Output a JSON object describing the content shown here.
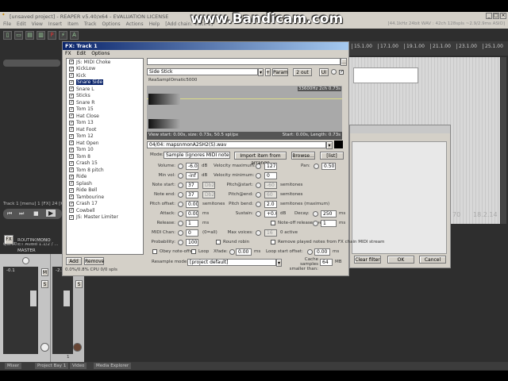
{
  "watermark": "www.Bandicam.com",
  "window": {
    "title": "[unsaved project] - REAPER v5.40/x64 - EVALUATION LICENSE",
    "status": "[44.1kHz 24bit WAV : 42ch 128spls ~2.9/2.9ms ASIO]",
    "minimize": "_",
    "maximize": "□",
    "close": "×"
  },
  "menu": [
    "File",
    "Edit",
    "View",
    "Insert",
    "Item",
    "Track",
    "Options",
    "Actions",
    "Help",
    "[Add chain: Track 1]"
  ],
  "ruler": [
    "15.1.00",
    "17.1.00",
    "19.1.00",
    "21.1.00",
    "23.1.00",
    "25.1.00"
  ],
  "track_info": "Track 1 [menu] 1 [FX] 24 [Kick...",
  "audio_device": "QUARTET Audio 1.1/2 / ...",
  "time_readout": "18.2.14",
  "time_readout2": "70",
  "fx": {
    "title": "FX: Track 1",
    "menu": [
      "FX",
      "Edit",
      "Options"
    ],
    "items": [
      {
        "label": "JS: MIDI Choke",
        "checked": true
      },
      {
        "label": "KickLow",
        "checked": true
      },
      {
        "label": "Kick",
        "checked": true
      },
      {
        "label": "Snare Side",
        "checked": true,
        "selected": true
      },
      {
        "label": "Snare L",
        "checked": true
      },
      {
        "label": "Sticks",
        "checked": true
      },
      {
        "label": "Snare R",
        "checked": true
      },
      {
        "label": "Tom 15",
        "checked": true
      },
      {
        "label": "Hat Close",
        "checked": true
      },
      {
        "label": "Tom 13",
        "checked": true
      },
      {
        "label": "Hat Foot",
        "checked": true
      },
      {
        "label": "Tom 12",
        "checked": true
      },
      {
        "label": "Hat Open",
        "checked": true
      },
      {
        "label": "Tom 10",
        "checked": true
      },
      {
        "label": "Tom 8",
        "checked": true
      },
      {
        "label": "Crash 15",
        "checked": true
      },
      {
        "label": "Tom 8 pitch",
        "checked": true
      },
      {
        "label": "Ride",
        "checked": true
      },
      {
        "label": "Splash",
        "checked": true
      },
      {
        "label": "Ride Bell",
        "checked": true
      },
      {
        "label": "Tambourine",
        "checked": true
      },
      {
        "label": "Crash 17",
        "checked": true
      },
      {
        "label": "Cowbell",
        "checked": true
      },
      {
        "label": "JS: Master Limiter",
        "checked": true
      }
    ],
    "add": "Add",
    "remove": "Remove",
    "cpu": "0.0%/0.8% CPU 0/0 spls",
    "preset": "Side Stick",
    "plus": "+",
    "param": "Param",
    "out": "2 out",
    "ui": "UI",
    "plugin_name": "ReaSamplOmatic5000",
    "wave_info": "33600Hz 2ch 0.73s",
    "view_info": "View start: 0.00s, size: 0.73s, 50.5 spl/px",
    "start_info": "Start: 0.00s, Length: 0.73s",
    "file": "04/04: mapsnmonA2SH2(S).wav",
    "mode_label": "Mode:",
    "mode": "Sample (ignores MIDI note)",
    "import": "Import item from arrange",
    "browse": "Browse...",
    "list": "[list]",
    "volume_label": "Volume:",
    "volume": "-6.0",
    "db": "dB",
    "minvol_label": "Min vol:",
    "minvol": "-inf",
    "notestart_label": "Note start:",
    "notestart": "37",
    "notestart_name": "Db2",
    "noteend_label": "Note end:",
    "noteend": "37",
    "noteend_name": "Db2",
    "pitchoffset_label": "Pitch offset:",
    "pitchoffset": "0.00",
    "semitones": "semitones",
    "attack_label": "Attack:",
    "attack": "0.00",
    "ms": "ms",
    "release_label": "Release:",
    "release": "1",
    "midichan_label": "MIDI Chan:",
    "midichan": "0",
    "midichan_hint": "(0=all)",
    "probability_label": "Probability:",
    "probability": "100",
    "round_robin": "Round robin",
    "velmax_label": "Velocity maximum:",
    "velmax": "127",
    "velmin_label": "Velocity minimum:",
    "velmin": "0",
    "pitchstart_label": "Pitch@start:",
    "pitchstart": "-60",
    "pitchend_label": "Pitch@end:",
    "pitchend": "60",
    "pitchbend_label": "Pitch bend:",
    "pitchbend": "2.0",
    "semitones_max": "semitones (maximum)",
    "sustain_label": "Sustain:",
    "sustain": "+0.0",
    "decay_label": "Decay:",
    "decay": "250",
    "noteoff_override": "Note-off release override:",
    "noteoff_value": "1",
    "maxvoices_label": "Max voices:",
    "maxvoices": "16",
    "active": "0 active",
    "pan_label": "Pan:",
    "pan": "0.50",
    "remove_played": "Remove played notes from FX chain MIDI stream",
    "obey_noteoffs": "Obey note-offs",
    "loop": "Loop",
    "xfade_label": "Xfade:",
    "xfade": "0.00",
    "loopstart_label": "Loop start offset:",
    "loopstart": "0.00",
    "resample_label": "Resample mode:",
    "resample": "[project default]",
    "cache_label": "Cache samples smaller than:",
    "cache": "64",
    "mb": "MB"
  },
  "dialog2": {
    "clear_filter": "Clear filter",
    "ok": "OK",
    "cancel": "Cancel"
  },
  "mixer": {
    "master": "MASTER",
    "fx": "FX",
    "routing": "ROUTING",
    "mono": "MONO",
    "m": "M",
    "s": "S",
    "track_num": "1",
    "master_peak": "-0.1",
    "track_peak": "-2.3"
  },
  "tabs": [
    "Mixer",
    "Project Bay 1",
    "Video",
    "Media Explorer"
  ]
}
